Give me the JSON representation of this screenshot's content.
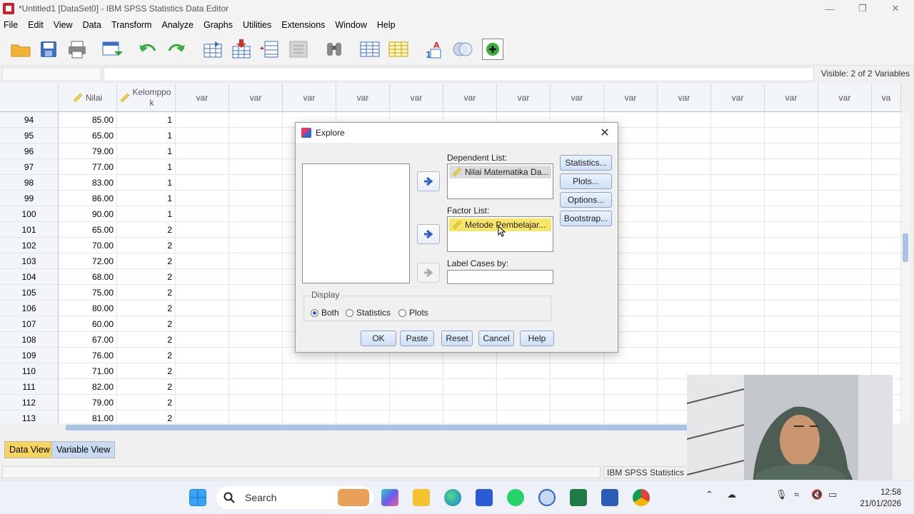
{
  "window": {
    "title": "*Untitled1 [DataSet0] - IBM SPSS Statistics Data Editor"
  },
  "menu": [
    "File",
    "Edit",
    "View",
    "Data",
    "Transform",
    "Analyze",
    "Graphs",
    "Utilities",
    "Extensions",
    "Window",
    "Help"
  ],
  "toolbar_icons": [
    "open-folder-icon",
    "save-icon",
    "print-icon",
    "recall-dialog-icon",
    "undo-icon",
    "redo-icon",
    "goto-case-icon",
    "goto-variable-icon",
    "variables-icon",
    "run-descriptives-icon",
    "find-icon",
    "split-file-icon",
    "select-cases-icon",
    "value-labels-icon",
    "use-sets-icon",
    "show-all-variables-icon"
  ],
  "info_bar": {
    "visible": "Visible: 2 of 2 Variables"
  },
  "grid": {
    "columns": [
      "Nilai",
      "Kelomppok",
      "var",
      "var",
      "var",
      "var",
      "var",
      "var",
      "var",
      "var",
      "var",
      "var",
      "var",
      "var",
      "var",
      "var",
      "va"
    ],
    "rows": [
      {
        "n": "94",
        "nilai": "85.00",
        "kel": "1"
      },
      {
        "n": "95",
        "nilai": "65.00",
        "kel": "1"
      },
      {
        "n": "96",
        "nilai": "79.00",
        "kel": "1"
      },
      {
        "n": "97",
        "nilai": "77.00",
        "kel": "1"
      },
      {
        "n": "98",
        "nilai": "83.00",
        "kel": "1"
      },
      {
        "n": "99",
        "nilai": "86.00",
        "kel": "1"
      },
      {
        "n": "100",
        "nilai": "90.00",
        "kel": "1"
      },
      {
        "n": "101",
        "nilai": "65.00",
        "kel": "2"
      },
      {
        "n": "102",
        "nilai": "70.00",
        "kel": "2"
      },
      {
        "n": "103",
        "nilai": "72.00",
        "kel": "2"
      },
      {
        "n": "104",
        "nilai": "68.00",
        "kel": "2"
      },
      {
        "n": "105",
        "nilai": "75.00",
        "kel": "2"
      },
      {
        "n": "106",
        "nilai": "80.00",
        "kel": "2"
      },
      {
        "n": "107",
        "nilai": "60.00",
        "kel": "2"
      },
      {
        "n": "108",
        "nilai": "67.00",
        "kel": "2"
      },
      {
        "n": "109",
        "nilai": "76.00",
        "kel": "2"
      },
      {
        "n": "110",
        "nilai": "71.00",
        "kel": "2"
      },
      {
        "n": "111",
        "nilai": "82.00",
        "kel": "2"
      },
      {
        "n": "112",
        "nilai": "79.00",
        "kel": "2"
      },
      {
        "n": "113",
        "nilai": "81.00",
        "kel": "2"
      }
    ]
  },
  "tabs": {
    "data_view": "Data View",
    "variable_view": "Variable View"
  },
  "status": {
    "processor": "IBM SPSS Statistics"
  },
  "dialog": {
    "title": "Explore",
    "dependent_label": "Dependent List:",
    "dependent_item": "Nilai Matematika Da...",
    "factor_label": "Factor List:",
    "factor_item": "Metode Pembelajar...",
    "label_cases": "Label Cases by:",
    "side_buttons": [
      "Statistics...",
      "Plots...",
      "Options...",
      "Bootstrap..."
    ],
    "display": {
      "legend": "Display",
      "options": [
        "Both",
        "Statistics",
        "Plots"
      ],
      "selected": "Both"
    },
    "buttons": [
      "OK",
      "Paste",
      "Reset",
      "Cancel",
      "Help"
    ]
  },
  "taskbar": {
    "search": "Search",
    "time": "12:58",
    "date": "21/01/2026"
  }
}
